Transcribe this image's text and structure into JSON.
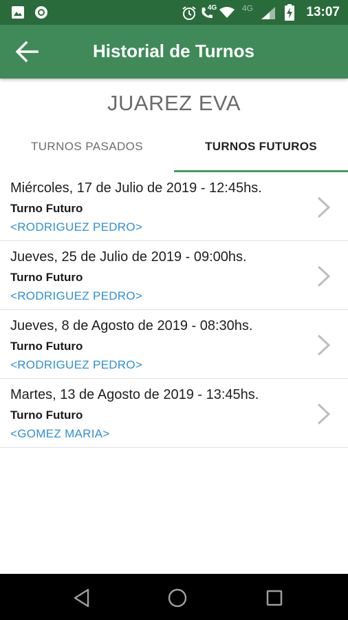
{
  "status_bar": {
    "time": "13:07",
    "network_label": "4G",
    "icons": [
      "image-icon",
      "circle-app-icon",
      "alarm-icon",
      "call-4g-icon",
      "wifi-icon",
      "signal-4g-icon",
      "battery-charging-icon"
    ]
  },
  "app_bar": {
    "title": "Historial de Turnos",
    "back_icon": "arrow-back-icon"
  },
  "patient": {
    "name": "JUAREZ EVA"
  },
  "tabs": [
    {
      "label": "TURNOS PASADOS",
      "selected": false
    },
    {
      "label": "TURNOS FUTUROS",
      "selected": true
    }
  ],
  "appointments": [
    {
      "date": "Miércoles, 17 de Julio de 2019 - 12:45hs.",
      "type": "Turno Futuro",
      "doctor": "<RODRIGUEZ PEDRO>"
    },
    {
      "date": "Jueves, 25 de Julio de 2019 - 09:00hs.",
      "type": "Turno Futuro",
      "doctor": "<RODRIGUEZ PEDRO>"
    },
    {
      "date": "Jueves, 8 de Agosto de 2019 - 08:30hs.",
      "type": "Turno Futuro",
      "doctor": "<RODRIGUEZ PEDRO>"
    },
    {
      "date": "Martes, 13 de Agosto de 2019 - 13:45hs.",
      "type": "Turno Futuro",
      "doctor": "<GOMEZ MARIA>"
    }
  ],
  "nav_bar": {
    "icons": [
      "back-triangle-icon",
      "home-circle-icon",
      "recents-square-icon"
    ]
  },
  "colors": {
    "status_bar": "#2a6b3c",
    "app_bar": "#3f8a58",
    "tab_indicator": "#3f9e62",
    "doctor_link": "#2f8fd6"
  }
}
